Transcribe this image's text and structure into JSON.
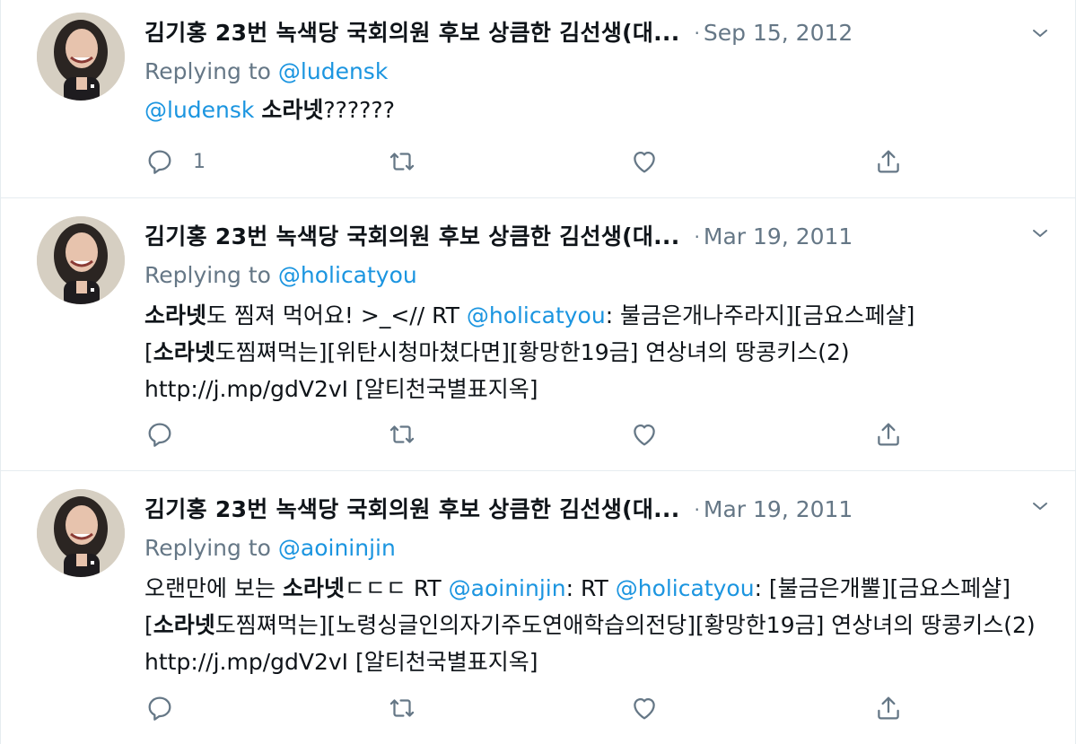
{
  "tweets": [
    {
      "name": "김기홍 23번 녹색당 국회의원 후보 상큼한 김선생(대...",
      "date": "Sep 15, 2012",
      "replying_prefix": "Replying to",
      "replying_handle": "@ludensk",
      "body": [
        {
          "text": "@ludensk",
          "style": "link"
        },
        {
          "text": " ",
          "style": "plain"
        },
        {
          "text": "소라넷",
          "style": "bold"
        },
        {
          "text": "??????",
          "style": "plain"
        }
      ],
      "reply_count": "1"
    },
    {
      "name": "김기홍 23번 녹색당 국회의원 후보 상큼한 김선생(대...",
      "date": "Mar 19, 2011",
      "replying_prefix": "Replying to",
      "replying_handle": "@holicatyou",
      "body": [
        {
          "text": "소라넷",
          "style": "bold"
        },
        {
          "text": "도 찜져 먹어요! >_<// RT ",
          "style": "plain"
        },
        {
          "text": "@holicatyou",
          "style": "link"
        },
        {
          "text": ": 불금은개나주라지][금요스페샬][",
          "style": "plain"
        },
        {
          "text": "소라넷",
          "style": "bold"
        },
        {
          "text": "도찜쪄먹는][위탄시청마쳤다면][황망한19금] 연상녀의 땅콩키스(2) http://j.mp/gdV2vI [알티천국별표지옥]",
          "style": "plain"
        }
      ],
      "reply_count": ""
    },
    {
      "name": "김기홍 23번 녹색당 국회의원 후보 상큼한 김선생(대...",
      "date": "Mar 19, 2011",
      "replying_prefix": "Replying to",
      "replying_handle": "@aoininjin",
      "body": [
        {
          "text": "오랜만에 보는 ",
          "style": "plain"
        },
        {
          "text": "소라넷",
          "style": "bold"
        },
        {
          "text": "ㄷㄷㄷ RT ",
          "style": "plain"
        },
        {
          "text": "@aoininjin",
          "style": "link"
        },
        {
          "text": ": RT ",
          "style": "plain"
        },
        {
          "text": "@holicatyou",
          "style": "link"
        },
        {
          "text": ": [불금은개뿔][금요스페샬][",
          "style": "plain"
        },
        {
          "text": "소라넷",
          "style": "bold"
        },
        {
          "text": "도찜쪄먹는][노령싱글인의자기주도연애학습의전당][황망한19금] 연상녀의 땅콩키스(2) http://j.mp/gdV2vI [알티천국별표지옥]",
          "style": "plain"
        }
      ],
      "reply_count": ""
    }
  ],
  "colors": {
    "link": "#1b95e0",
    "secondary": "#657786",
    "text": "#0f1419",
    "divider": "#e6ecf0"
  },
  "icons": [
    "reply-icon",
    "retweet-icon",
    "like-icon",
    "share-icon",
    "chevron-down-icon",
    "avatar"
  ]
}
